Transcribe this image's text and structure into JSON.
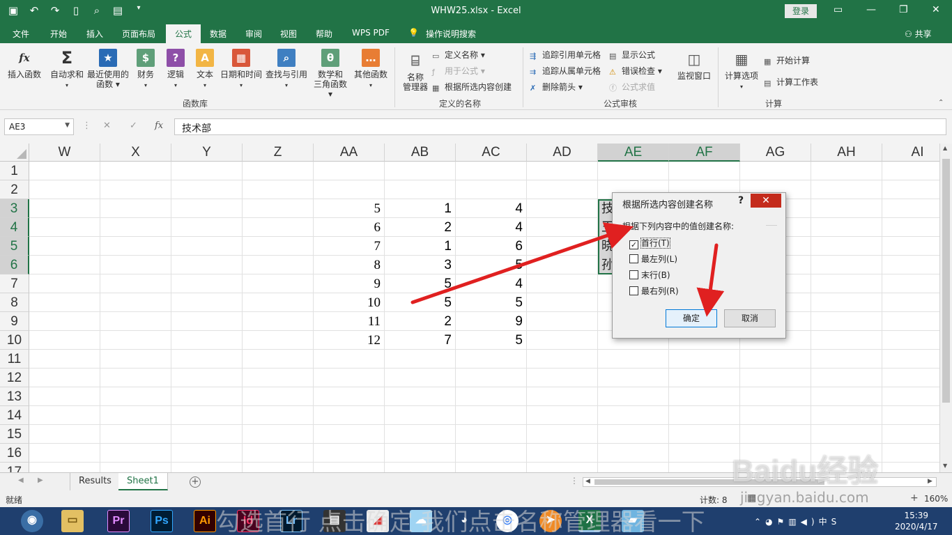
{
  "window": {
    "title": "WHW25.xlsx  -  Excel",
    "login_label": "登录",
    "share_label": "共享"
  },
  "ribbon_tabs": [
    "文件",
    "开始",
    "插入",
    "页面布局",
    "公式",
    "数据",
    "审阅",
    "视图",
    "帮助",
    "WPS PDF",
    "操作说明搜索"
  ],
  "active_tab": "公式",
  "ribbon": {
    "function_library": {
      "insert_function": "插入函数",
      "autosum": "自动求和",
      "recent_1": "最近使用的",
      "recent_2": "函数",
      "financial": "财务",
      "logical": "逻辑",
      "text": "文本",
      "datetime": "日期和时间",
      "lookup": "查找与引用",
      "math_1": "数学和",
      "math_2": "三角函数",
      "other": "其他函数",
      "group_label": "函数库"
    },
    "defined_names": {
      "name_manager_1": "名称",
      "name_manager_2": "管理器",
      "define_name": "定义名称",
      "use_in_formula": "用于公式",
      "create_from_selection": "根据所选内容创建",
      "group_label": "定义的名称"
    },
    "formula_auditing": {
      "trace_precedents": "追踪引用单元格",
      "trace_dependents": "追踪从属单元格",
      "remove_arrows": "删除箭头",
      "show_formulas": "显示公式",
      "error_checking": "错误检查",
      "evaluate_formula": "公式求值",
      "watch_window": "监视窗口",
      "group_label": "公式审核"
    },
    "calculation": {
      "calc_options": "计算选项",
      "calc_now": "开始计算",
      "calc_sheet": "计算工作表",
      "group_label": "计算"
    }
  },
  "formula_bar": {
    "name_box": "AE3",
    "fx_label": "fx",
    "content": "技术部"
  },
  "grid": {
    "columns": [
      "W",
      "X",
      "Y",
      "Z",
      "AA",
      "AB",
      "AC",
      "AD",
      "AE",
      "AF",
      "AG",
      "AH",
      "AI"
    ],
    "rows": [
      "1",
      "2",
      "3",
      "4",
      "5",
      "6",
      "7",
      "8",
      "9",
      "10",
      "11",
      "12",
      "13",
      "14",
      "15",
      "16",
      "17"
    ],
    "aa": [
      "5",
      "6",
      "7",
      "8",
      "9",
      "10",
      "11",
      "12"
    ],
    "ab": [
      "1",
      "2",
      "1",
      "3",
      "5",
      "5",
      "2",
      "7"
    ],
    "ac": [
      "4",
      "4",
      "6",
      "5",
      "4",
      "5",
      "9",
      "5"
    ],
    "ae_visible": [
      "技",
      "王",
      "晓",
      "孙"
    ]
  },
  "dialog": {
    "title": "根据所选内容创建名称",
    "help": "?",
    "close": "✕",
    "group_title": "根据下列内容中的值创建名称:",
    "options": [
      {
        "label": "首行(T)",
        "checked": true
      },
      {
        "label": "最左列(L)",
        "checked": false
      },
      {
        "label": "末行(B)",
        "checked": false
      },
      {
        "label": "最右列(R)",
        "checked": false
      }
    ],
    "ok": "确定",
    "cancel": "取消"
  },
  "sheets": [
    "Results",
    "Sheet1"
  ],
  "active_sheet": "Sheet1",
  "status": {
    "left": "就绪",
    "count": "计数: 8",
    "zoom": "160%"
  },
  "taskbar": {
    "apps": [
      "Pr",
      "Ps",
      "Ai",
      "Id",
      "Lr"
    ],
    "time": "15:39",
    "date": "2020/4/17",
    "ime": "中"
  },
  "overlay": {
    "watermark_brand": "Baidu经验",
    "watermark_url": "jingyan.baidu.com",
    "subtitle": "勾选首行 点击确定 我们点击名称管理器看一下"
  },
  "colors": {
    "excel_green": "#217346",
    "arrow_red": "#e02020",
    "close_red": "#c42b1c"
  }
}
